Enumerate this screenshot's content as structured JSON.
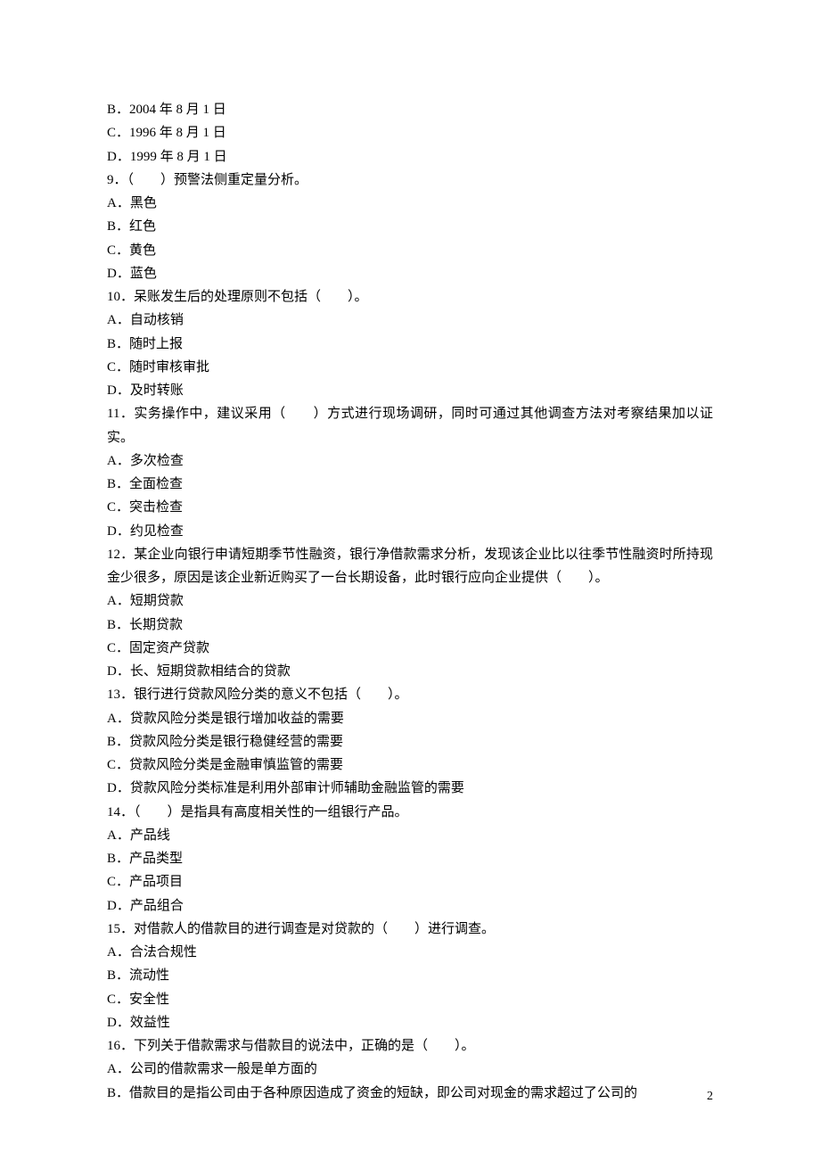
{
  "q8_options": {
    "B": "B．2004 年 8 月 1 日",
    "C": "C．1996 年 8 月 1 日",
    "D": "D．1999 年 8 月 1 日"
  },
  "q9": {
    "stem": "9．（　　）预警法侧重定量分析。",
    "A": "A．黑色",
    "B": "B．红色",
    "C": "C．黄色",
    "D": "D．蓝色"
  },
  "q10": {
    "stem": "10．呆账发生后的处理原则不包括（　　）。",
    "A": "A．自动核销",
    "B": "B．随时上报",
    "C": "C．随时审核审批",
    "D": "D．及时转账"
  },
  "q11": {
    "stem": "11．实务操作中，建议采用（　　）方式进行现场调研，同时可通过其他调查方法对考察结果加以证实。",
    "A": "A．多次检查",
    "B": "B．全面检查",
    "C": "C．突击检查",
    "D": "D．约见检查"
  },
  "q12": {
    "stem": "12．某企业向银行申请短期季节性融资，银行净借款需求分析，发现该企业比以往季节性融资时所持现金少很多，原因是该企业新近购买了一台长期设备，此时银行应向企业提供（　　）。",
    "A": "A．短期贷款",
    "B": "B．长期贷款",
    "C": "C．固定资产贷款",
    "D": "D．长、短期贷款相结合的贷款"
  },
  "q13": {
    "stem": "13．银行进行贷款风险分类的意义不包括（　　）。",
    "A": "A．贷款风险分类是银行增加收益的需要",
    "B": "B．贷款风险分类是银行稳健经营的需要",
    "C": "C．贷款风险分类是金融审慎监管的需要",
    "D": "D．贷款风险分类标准是利用外部审计师辅助金融监管的需要"
  },
  "q14": {
    "stem": "14．（　　）是指具有高度相关性的一组银行产品。",
    "A": "A．产品线",
    "B": "B．产品类型",
    "C": "C．产品项目",
    "D": "D．产品组合"
  },
  "q15": {
    "stem": "15．对借款人的借款目的进行调查是对贷款的（　　）进行调查。",
    "A": "A．合法合规性",
    "B": "B．流动性",
    "C": "C．安全性",
    "D": "D．效益性"
  },
  "q16": {
    "stem": "16．下列关于借款需求与借款目的说法中，正确的是（　　）。",
    "A": "A．公司的借款需求一般是单方面的",
    "B": "B．借款目的是指公司由于各种原因造成了资金的短缺，即公司对现金的需求超过了公司的"
  },
  "page_number": "2"
}
